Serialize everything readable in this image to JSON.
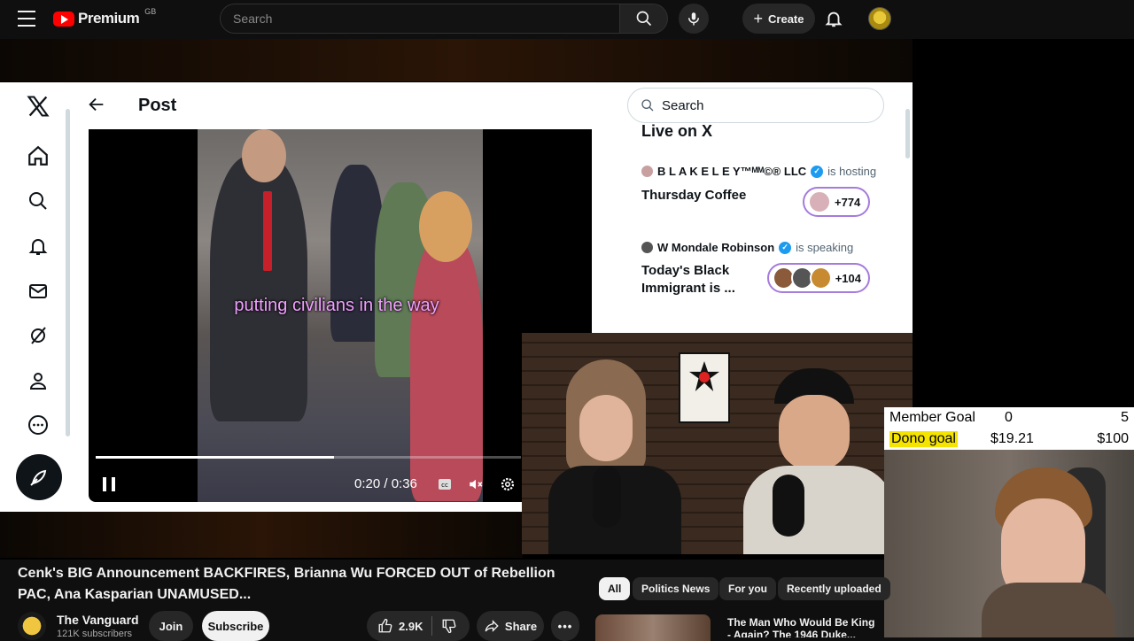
{
  "youtube": {
    "logo_text": "Premium",
    "region": "GB",
    "search_placeholder": "Search",
    "create_label": "Create",
    "video_title": "Cenk's BIG Announcement BACKFIRES, Brianna Wu FORCED OUT of Rebellion PAC, Ana Kasparian UNAMUSED...",
    "channel": {
      "name": "The Vanguard",
      "subscribers": "121K subscribers"
    },
    "join_label": "Join",
    "subscribe_label": "Subscribe",
    "likes": "2.9K",
    "share_label": "Share",
    "chips": [
      "All",
      "Politics News",
      "For you",
      "Recently uploaded"
    ],
    "recommended_title": "The Man Who Would Be King - Again? The 1946 Duke..."
  },
  "x": {
    "header_title": "Post",
    "search_placeholder": "Search",
    "live_title": "Live on X",
    "spaces": [
      {
        "host": "B L A K E L E Y™ᴹᴹ©® LLC",
        "status": "is hosting",
        "title": "Thursday Coffee",
        "listeners": "+774"
      },
      {
        "host": "W Mondale Robinson",
        "status": "is speaking",
        "title": "Today's Black Immigrant is ...",
        "listeners": "+104"
      }
    ],
    "video": {
      "caption": "putting civilians in the way",
      "time": "0:20 / 0:36",
      "progress": 0.56
    }
  },
  "goals": {
    "member": {
      "label": "Member Goal",
      "current": "0",
      "target": "5"
    },
    "dono": {
      "label": "Dono goal",
      "current": "$19.21",
      "target": "$100"
    }
  }
}
